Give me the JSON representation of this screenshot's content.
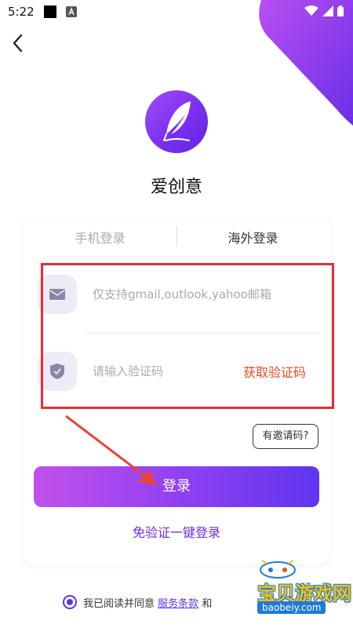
{
  "status_bar": {
    "time": "5:22"
  },
  "app": {
    "name": "爱创意"
  },
  "tabs": [
    {
      "label": "手机登录",
      "active": false
    },
    {
      "label": "海外登录",
      "active": true
    }
  ],
  "email": {
    "placeholder": "仅支持gmail,outlook,yahoo邮箱",
    "value": ""
  },
  "code": {
    "placeholder": "请输入验证码",
    "value": "",
    "get_code_label": "获取验证码"
  },
  "invite": {
    "label": "有邀请码?"
  },
  "login": {
    "label": "登录"
  },
  "one_tap": {
    "label": "免验证一键登录"
  },
  "agreement": {
    "prefix": "我已阅读并同意",
    "terms_link": "服务条款",
    "and": "和",
    "checked": true
  },
  "watermark": {
    "title": "宝贝游戏网",
    "url": "baobeiy.com"
  },
  "colors": {
    "accent": "#6b2ee0",
    "highlight": "#e0303a",
    "get_code": "#e54d26"
  },
  "icons": [
    "back-arrow-icon",
    "mail-icon",
    "shield-icon",
    "feather-icon",
    "wifi-icon",
    "signal-icon",
    "battery-icon"
  ]
}
